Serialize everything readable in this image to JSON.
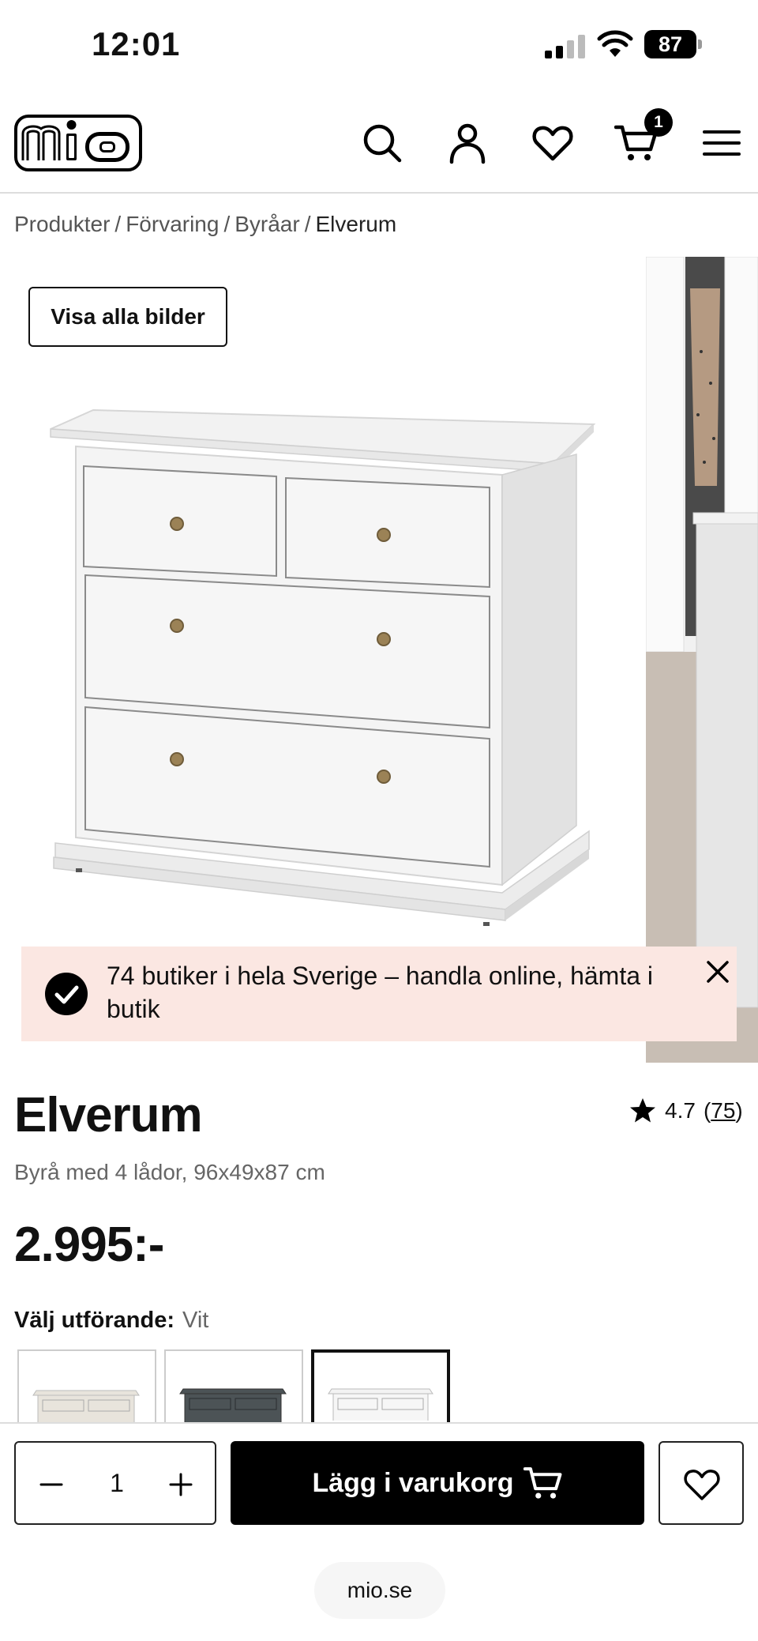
{
  "status_bar": {
    "time": "12:01",
    "battery": "87"
  },
  "header": {
    "logo_text": "mio",
    "cart_count": "1"
  },
  "breadcrumb": {
    "items": [
      "Produkter",
      "Förvaring",
      "Byråar"
    ],
    "separator": "/",
    "current": "Elverum"
  },
  "gallery": {
    "show_all_label": "Visa alla bilder"
  },
  "toast": {
    "message": "74 butiker i hela Sverige – handla online, hämta i butik"
  },
  "product": {
    "title": "Elverum",
    "subtitle": "Byrå med 4 lådor, 96x49x87 cm",
    "price": "2.995:-",
    "rating": "4.7",
    "review_count_open": "(",
    "review_count": "75",
    "review_count_close": ")",
    "variant_label": "Välj utförande:",
    "variant_value": "Vit",
    "swatches": [
      {
        "color": "#e8e4dc",
        "selected": false
      },
      {
        "color": "#4c5356",
        "selected": false
      },
      {
        "color": "#f3f3f3",
        "selected": true
      }
    ]
  },
  "bottom_bar": {
    "quantity": "1",
    "add_to_cart_label": "Lägg i varukorg",
    "url": "mio.se"
  }
}
